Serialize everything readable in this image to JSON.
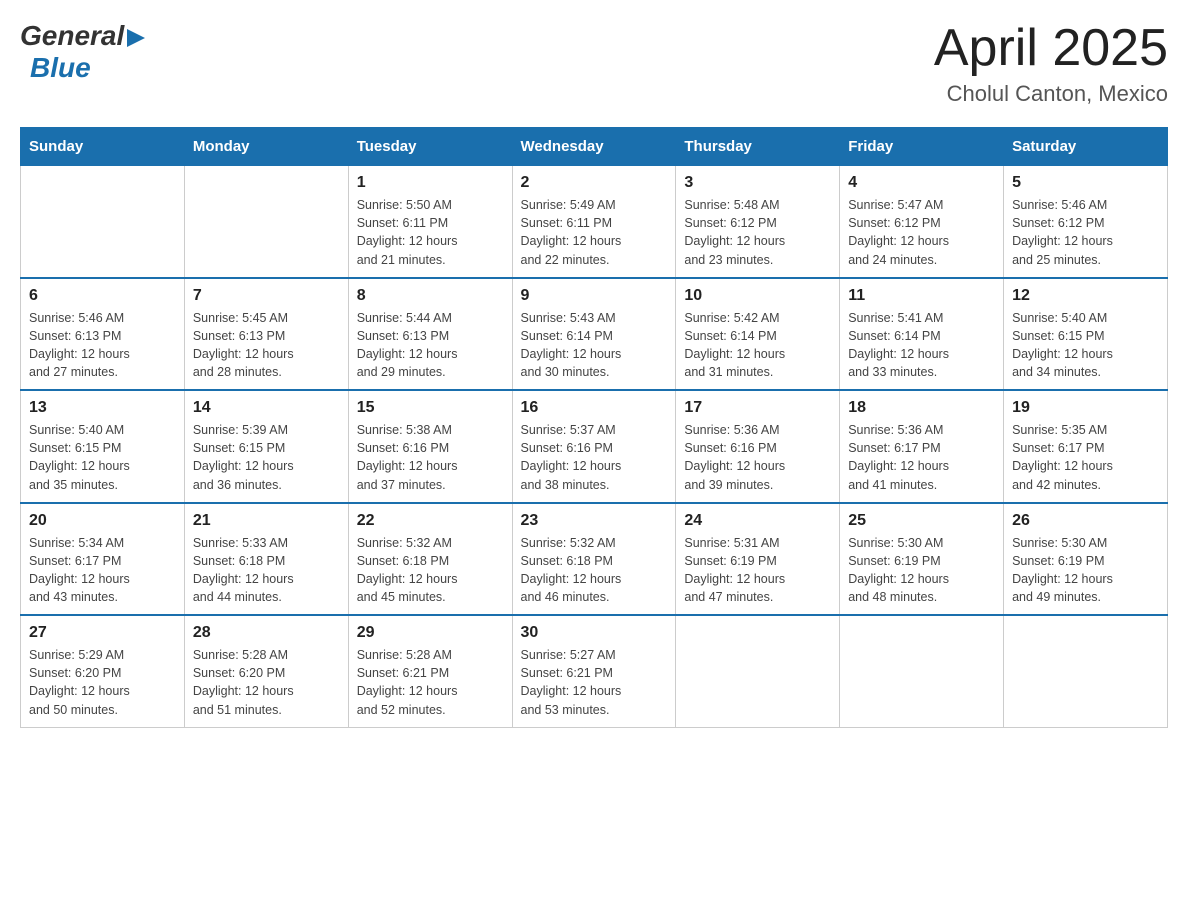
{
  "header": {
    "logo": {
      "general": "General",
      "arrow": "▶",
      "blue": "Blue"
    },
    "title": "April 2025",
    "subtitle": "Cholul Canton, Mexico"
  },
  "calendar": {
    "days_of_week": [
      "Sunday",
      "Monday",
      "Tuesday",
      "Wednesday",
      "Thursday",
      "Friday",
      "Saturday"
    ],
    "weeks": [
      [
        {
          "day": "",
          "info": ""
        },
        {
          "day": "",
          "info": ""
        },
        {
          "day": "1",
          "info": "Sunrise: 5:50 AM\nSunset: 6:11 PM\nDaylight: 12 hours\nand 21 minutes."
        },
        {
          "day": "2",
          "info": "Sunrise: 5:49 AM\nSunset: 6:11 PM\nDaylight: 12 hours\nand 22 minutes."
        },
        {
          "day": "3",
          "info": "Sunrise: 5:48 AM\nSunset: 6:12 PM\nDaylight: 12 hours\nand 23 minutes."
        },
        {
          "day": "4",
          "info": "Sunrise: 5:47 AM\nSunset: 6:12 PM\nDaylight: 12 hours\nand 24 minutes."
        },
        {
          "day": "5",
          "info": "Sunrise: 5:46 AM\nSunset: 6:12 PM\nDaylight: 12 hours\nand 25 minutes."
        }
      ],
      [
        {
          "day": "6",
          "info": "Sunrise: 5:46 AM\nSunset: 6:13 PM\nDaylight: 12 hours\nand 27 minutes."
        },
        {
          "day": "7",
          "info": "Sunrise: 5:45 AM\nSunset: 6:13 PM\nDaylight: 12 hours\nand 28 minutes."
        },
        {
          "day": "8",
          "info": "Sunrise: 5:44 AM\nSunset: 6:13 PM\nDaylight: 12 hours\nand 29 minutes."
        },
        {
          "day": "9",
          "info": "Sunrise: 5:43 AM\nSunset: 6:14 PM\nDaylight: 12 hours\nand 30 minutes."
        },
        {
          "day": "10",
          "info": "Sunrise: 5:42 AM\nSunset: 6:14 PM\nDaylight: 12 hours\nand 31 minutes."
        },
        {
          "day": "11",
          "info": "Sunrise: 5:41 AM\nSunset: 6:14 PM\nDaylight: 12 hours\nand 33 minutes."
        },
        {
          "day": "12",
          "info": "Sunrise: 5:40 AM\nSunset: 6:15 PM\nDaylight: 12 hours\nand 34 minutes."
        }
      ],
      [
        {
          "day": "13",
          "info": "Sunrise: 5:40 AM\nSunset: 6:15 PM\nDaylight: 12 hours\nand 35 minutes."
        },
        {
          "day": "14",
          "info": "Sunrise: 5:39 AM\nSunset: 6:15 PM\nDaylight: 12 hours\nand 36 minutes."
        },
        {
          "day": "15",
          "info": "Sunrise: 5:38 AM\nSunset: 6:16 PM\nDaylight: 12 hours\nand 37 minutes."
        },
        {
          "day": "16",
          "info": "Sunrise: 5:37 AM\nSunset: 6:16 PM\nDaylight: 12 hours\nand 38 minutes."
        },
        {
          "day": "17",
          "info": "Sunrise: 5:36 AM\nSunset: 6:16 PM\nDaylight: 12 hours\nand 39 minutes."
        },
        {
          "day": "18",
          "info": "Sunrise: 5:36 AM\nSunset: 6:17 PM\nDaylight: 12 hours\nand 41 minutes."
        },
        {
          "day": "19",
          "info": "Sunrise: 5:35 AM\nSunset: 6:17 PM\nDaylight: 12 hours\nand 42 minutes."
        }
      ],
      [
        {
          "day": "20",
          "info": "Sunrise: 5:34 AM\nSunset: 6:17 PM\nDaylight: 12 hours\nand 43 minutes."
        },
        {
          "day": "21",
          "info": "Sunrise: 5:33 AM\nSunset: 6:18 PM\nDaylight: 12 hours\nand 44 minutes."
        },
        {
          "day": "22",
          "info": "Sunrise: 5:32 AM\nSunset: 6:18 PM\nDaylight: 12 hours\nand 45 minutes."
        },
        {
          "day": "23",
          "info": "Sunrise: 5:32 AM\nSunset: 6:18 PM\nDaylight: 12 hours\nand 46 minutes."
        },
        {
          "day": "24",
          "info": "Sunrise: 5:31 AM\nSunset: 6:19 PM\nDaylight: 12 hours\nand 47 minutes."
        },
        {
          "day": "25",
          "info": "Sunrise: 5:30 AM\nSunset: 6:19 PM\nDaylight: 12 hours\nand 48 minutes."
        },
        {
          "day": "26",
          "info": "Sunrise: 5:30 AM\nSunset: 6:19 PM\nDaylight: 12 hours\nand 49 minutes."
        }
      ],
      [
        {
          "day": "27",
          "info": "Sunrise: 5:29 AM\nSunset: 6:20 PM\nDaylight: 12 hours\nand 50 minutes."
        },
        {
          "day": "28",
          "info": "Sunrise: 5:28 AM\nSunset: 6:20 PM\nDaylight: 12 hours\nand 51 minutes."
        },
        {
          "day": "29",
          "info": "Sunrise: 5:28 AM\nSunset: 6:21 PM\nDaylight: 12 hours\nand 52 minutes."
        },
        {
          "day": "30",
          "info": "Sunrise: 5:27 AM\nSunset: 6:21 PM\nDaylight: 12 hours\nand 53 minutes."
        },
        {
          "day": "",
          "info": ""
        },
        {
          "day": "",
          "info": ""
        },
        {
          "day": "",
          "info": ""
        }
      ]
    ]
  }
}
